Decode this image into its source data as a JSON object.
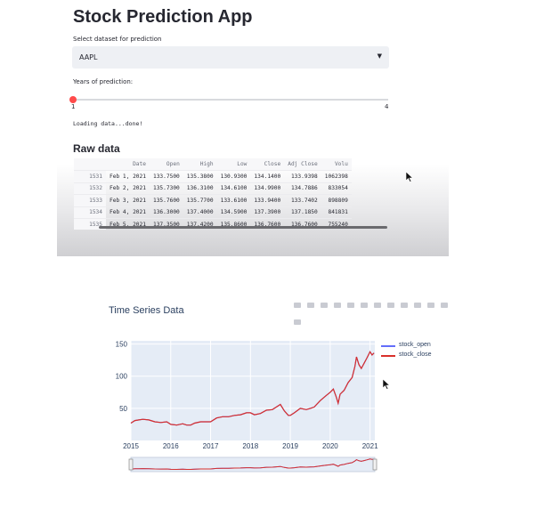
{
  "app": {
    "title": "Stock Prediction App",
    "select_label": "Select dataset for prediction",
    "select_value": "AAPL",
    "slider_label": "Years of prediction:",
    "slider_min": "1",
    "slider_max": "4",
    "slider_value": 1,
    "loading_text": "Loading data...done!",
    "raw_title": "Raw data"
  },
  "raw_table": {
    "columns": [
      "",
      "Date",
      "Open",
      "High",
      "Low",
      "Close",
      "Adj Close",
      "Volu"
    ],
    "rows": [
      [
        "1531",
        "Feb 1, 2021",
        "133.7500",
        "135.3800",
        "130.9300",
        "134.1400",
        "133.9398",
        "1062398"
      ],
      [
        "1532",
        "Feb 2, 2021",
        "135.7300",
        "136.3100",
        "134.6100",
        "134.9900",
        "134.7886",
        "833054"
      ],
      [
        "1533",
        "Feb 3, 2021",
        "135.7600",
        "135.7700",
        "133.6100",
        "133.9400",
        "133.7402",
        "898809"
      ],
      [
        "1534",
        "Feb 4, 2021",
        "136.3000",
        "137.4000",
        "134.5900",
        "137.3900",
        "137.1850",
        "841831"
      ],
      [
        "1535",
        "Feb 5, 2021",
        "137.3500",
        "137.4200",
        "135.8600",
        "136.7600",
        "136.7600",
        "755240"
      ]
    ]
  },
  "colors": {
    "accent": "#ff4b4b",
    "stock_open": "#636efa",
    "stock_close": "#d9302b",
    "plot_bg": "#e5ecf6"
  },
  "modebar_icons": [
    "camera-icon",
    "zoom-icon",
    "pan-icon",
    "box-select-icon",
    "lasso-icon",
    "zoom-in-icon",
    "zoom-out-icon",
    "autoscale-icon",
    "reset-axes-icon",
    "spike-lines-icon",
    "hover-closest-icon",
    "hover-compare-icon",
    "plotly-logo-icon"
  ],
  "chart_data": {
    "type": "line",
    "title": "Time Series Data",
    "xlabel": "",
    "ylabel": "",
    "x_ticks": [
      "2015",
      "2016",
      "2017",
      "2018",
      "2019",
      "2020",
      "2021"
    ],
    "y_ticks": [
      "50",
      "100",
      "150"
    ],
    "xlim": [
      2015.0,
      2021.12
    ],
    "ylim": [
      0,
      155
    ],
    "legend_position": "top-right",
    "rangeslider": true,
    "series": [
      {
        "name": "stock_open",
        "x": [
          2015.0,
          2015.1,
          2015.2,
          2015.3,
          2015.45,
          2015.6,
          2015.75,
          2015.9,
          2016.0,
          2016.15,
          2016.3,
          2016.4,
          2016.5,
          2016.6,
          2016.75,
          2016.9,
          2017.0,
          2017.15,
          2017.3,
          2017.45,
          2017.6,
          2017.75,
          2017.9,
          2018.0,
          2018.1,
          2018.25,
          2018.4,
          2018.55,
          2018.65,
          2018.75,
          2018.85,
          2018.95,
          2019.0,
          2019.1,
          2019.25,
          2019.4,
          2019.5,
          2019.6,
          2019.75,
          2019.9,
          2020.0,
          2020.08,
          2020.15,
          2020.2,
          2020.25,
          2020.35,
          2020.45,
          2020.55,
          2020.62,
          2020.66,
          2020.72,
          2020.78,
          2020.85,
          2020.92,
          2021.0,
          2021.05,
          2021.1
        ],
        "y": [
          27,
          31,
          32,
          33,
          32,
          29,
          28,
          29,
          25,
          24,
          26,
          24,
          24,
          27,
          29,
          29,
          29,
          35,
          37,
          37,
          39,
          40,
          43,
          43,
          40,
          42,
          47,
          48,
          52,
          56,
          46,
          39,
          39,
          43,
          50,
          48,
          50,
          52,
          62,
          70,
          75,
          80,
          68,
          58,
          72,
          78,
          90,
          98,
          115,
          130,
          118,
          112,
          120,
          128,
          138,
          133,
          136
        ]
      },
      {
        "name": "stock_close",
        "x": [
          2015.0,
          2015.1,
          2015.2,
          2015.3,
          2015.45,
          2015.6,
          2015.75,
          2015.9,
          2016.0,
          2016.15,
          2016.3,
          2016.4,
          2016.5,
          2016.6,
          2016.75,
          2016.9,
          2017.0,
          2017.15,
          2017.3,
          2017.45,
          2017.6,
          2017.75,
          2017.9,
          2018.0,
          2018.1,
          2018.25,
          2018.4,
          2018.55,
          2018.65,
          2018.75,
          2018.85,
          2018.95,
          2019.0,
          2019.1,
          2019.25,
          2019.4,
          2019.5,
          2019.6,
          2019.75,
          2019.9,
          2020.0,
          2020.08,
          2020.15,
          2020.2,
          2020.25,
          2020.35,
          2020.45,
          2020.55,
          2020.62,
          2020.66,
          2020.72,
          2020.78,
          2020.85,
          2020.92,
          2021.0,
          2021.05,
          2021.1
        ],
        "y": [
          27,
          31,
          32,
          33,
          32,
          29,
          28,
          29,
          25,
          24,
          26,
          24,
          24,
          27,
          29,
          29,
          29,
          35,
          37,
          37,
          39,
          40,
          43,
          43,
          40,
          42,
          47,
          48,
          52,
          56,
          46,
          39,
          39,
          43,
          50,
          48,
          50,
          52,
          62,
          70,
          75,
          80,
          68,
          58,
          72,
          78,
          90,
          98,
          115,
          130,
          118,
          112,
          120,
          128,
          138,
          133,
          136
        ]
      }
    ]
  }
}
